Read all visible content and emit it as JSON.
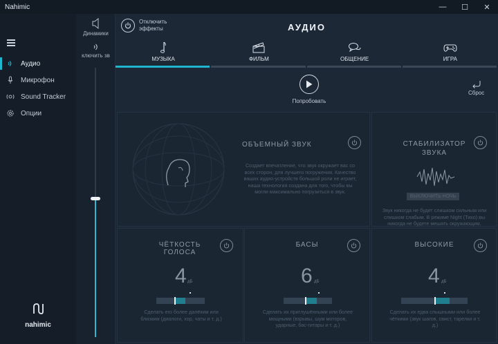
{
  "window": {
    "title": "Nahimic",
    "minimize": "—",
    "maximize": "☐",
    "close": "✕"
  },
  "sidebar": {
    "items": [
      {
        "label": "Аудио",
        "icon": "speaker-icon",
        "active": true
      },
      {
        "label": "Микрофон",
        "icon": "microphone-icon",
        "active": false
      },
      {
        "label": "Sound Tracker",
        "icon": "sound-tracker-icon",
        "active": false
      },
      {
        "label": "Опции",
        "icon": "gear-icon",
        "active": false
      }
    ],
    "brand": "nahimic"
  },
  "volume": {
    "device_label": "Динамики",
    "mute_label": "ключить зв",
    "level": 0.37
  },
  "header": {
    "effects_toggle_label": "Отключить эффекты",
    "title": "АУДИО"
  },
  "tabs": [
    {
      "label": "МУЗЫКА",
      "icon": "music-note-icon",
      "active": true
    },
    {
      "label": "ФИЛЬМ",
      "icon": "clapperboard-icon",
      "active": false
    },
    {
      "label": "ОБЩЕНИЕ",
      "icon": "chat-bubbles-icon",
      "active": false
    },
    {
      "label": "ИГРА",
      "icon": "gamepad-icon",
      "active": false
    }
  ],
  "actions": {
    "try_label": "Попробовать",
    "reset_label": "Сброс"
  },
  "surround": {
    "title": "ОБЪЕМНЫЙ ЗВУК",
    "description": "Создает впечатление, что звук окружает вас со всех сторон, для лучшего погружения. Качество ваших аудио-устройств большой роли не играет, наша технология создана для того, чтобы вы могли максимально погрузиться в звук."
  },
  "stabilizer": {
    "title": "СТАБИЛИЗАТОР ЗВУКА",
    "button_label": "ВЫКЛЮЧИТЬ НОЧЬ",
    "description": "Звук никогда не будет слишком сильным или слишком слабым. В режиме Night (Тихо) вы никогда не будете мешать окружающим."
  },
  "voice": {
    "title": "ЧЁТКОСТЬ ГОЛОСА",
    "value": "4",
    "unit": "дБ",
    "level": 0.38,
    "description": "Сделать его более далёким или близким (диалоги, хор, чаты и т. д.)"
  },
  "bass": {
    "title": "БАСЫ",
    "value": "6",
    "unit": "дБ",
    "level": 0.46,
    "description": "Сделать их приглушёнными или более мощными (взрывы, шум моторов, ударные, бас-гитары и т. д.)"
  },
  "treble": {
    "title": "ВЫСОКИЕ",
    "value": "4",
    "unit": "дБ",
    "level": 0.51,
    "description": "Сделать их едва слышными или более чёткими (звук шагов, свист, тарелки и т. д.)"
  }
}
